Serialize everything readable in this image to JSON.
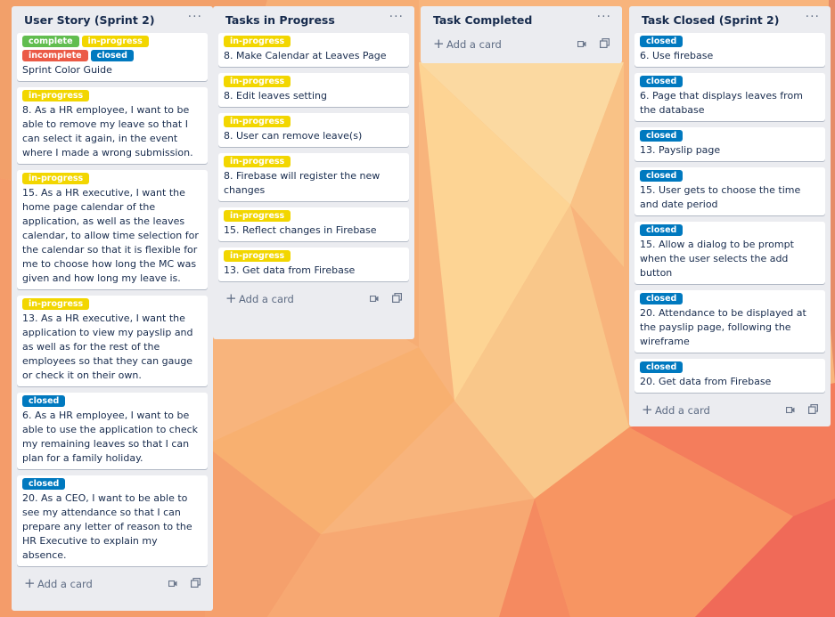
{
  "lists": [
    {
      "title": "User Story (Sprint 2)",
      "add_label": "Add a card",
      "cards": [
        {
          "labels": [
            {
              "text": "complete",
              "kind": "complete"
            },
            {
              "text": "in-progress",
              "kind": "in-progress"
            },
            {
              "text": "incomplete",
              "kind": "incomplete"
            },
            {
              "text": "closed",
              "kind": "closed"
            }
          ],
          "text": "Sprint Color Guide"
        },
        {
          "labels": [
            {
              "text": "in-progress",
              "kind": "in-progress"
            }
          ],
          "text": "8. As a HR employee, I want to be able to remove my leave so that I can select it again, in the event where I made a wrong submission."
        },
        {
          "labels": [
            {
              "text": "in-progress",
              "kind": "in-progress"
            }
          ],
          "text": "15. As a HR executive, I want the home page calendar of the application, as well as the leaves calendar, to allow time selection for the calendar so that it is flexible for me to choose how long the MC was given and how long my leave is."
        },
        {
          "labels": [
            {
              "text": "in-progress",
              "kind": "in-progress"
            }
          ],
          "text": "13. As a HR executive, I want the application to view my payslip and as well as for the rest of the employees so that they can gauge or check it on their own."
        },
        {
          "labels": [
            {
              "text": "closed",
              "kind": "closed"
            }
          ],
          "text": "6. As a HR employee, I want to be able to use the application to check my remaining leaves so that I can plan for a family holiday."
        },
        {
          "labels": [
            {
              "text": "closed",
              "kind": "closed"
            }
          ],
          "text": "20. As a CEO, I want to be able to see my attendance so that I can prepare any letter of reason to the HR Executive to explain my absence."
        }
      ]
    },
    {
      "title": "Tasks in Progress",
      "add_label": "Add a card",
      "cards": [
        {
          "labels": [
            {
              "text": "in-progress",
              "kind": "in-progress"
            }
          ],
          "text": "8. Make Calendar at Leaves Page"
        },
        {
          "labels": [
            {
              "text": "in-progress",
              "kind": "in-progress"
            }
          ],
          "text": "8. Edit leaves setting"
        },
        {
          "labels": [
            {
              "text": "in-progress",
              "kind": "in-progress"
            }
          ],
          "text": "8. User can remove leave(s)"
        },
        {
          "labels": [
            {
              "text": "in-progress",
              "kind": "in-progress"
            }
          ],
          "text": "8. Firebase will register the new changes"
        },
        {
          "labels": [
            {
              "text": "in-progress",
              "kind": "in-progress"
            }
          ],
          "text": "15. Reflect changes in Firebase"
        },
        {
          "labels": [
            {
              "text": "in-progress",
              "kind": "in-progress"
            }
          ],
          "text": "13. Get data from Firebase"
        }
      ]
    },
    {
      "title": "Task Completed",
      "add_label": "Add a card",
      "cards": []
    },
    {
      "title": "Task Closed (Sprint 2)",
      "add_label": "Add a card",
      "cards": [
        {
          "labels": [
            {
              "text": "closed",
              "kind": "closed"
            }
          ],
          "text": "6. Use firebase"
        },
        {
          "labels": [
            {
              "text": "closed",
              "kind": "closed"
            }
          ],
          "text": "6. Page that displays leaves from the database"
        },
        {
          "labels": [
            {
              "text": "closed",
              "kind": "closed"
            }
          ],
          "text": "13. Payslip page"
        },
        {
          "labels": [
            {
              "text": "closed",
              "kind": "closed"
            }
          ],
          "text": "15. User gets to choose the time and date period"
        },
        {
          "labels": [
            {
              "text": "closed",
              "kind": "closed"
            }
          ],
          "text": "15. Allow a dialog to be prompt when the user selects the add button"
        },
        {
          "labels": [
            {
              "text": "closed",
              "kind": "closed"
            }
          ],
          "text": "20. Attendance to be displayed at the payslip page, following the wireframe"
        },
        {
          "labels": [
            {
              "text": "closed",
              "kind": "closed"
            }
          ],
          "text": "20. Get data from Firebase"
        }
      ]
    }
  ],
  "icons": {
    "list_menu": "more-horizontal-icon",
    "add": "plus-icon",
    "template": "card-template-icon"
  },
  "colors": {
    "label_complete": "#61bd4f",
    "label_in_progress": "#f2d600",
    "label_incomplete": "#eb5a46",
    "label_closed": "#0079bf",
    "list_background": "#ebecf0"
  }
}
